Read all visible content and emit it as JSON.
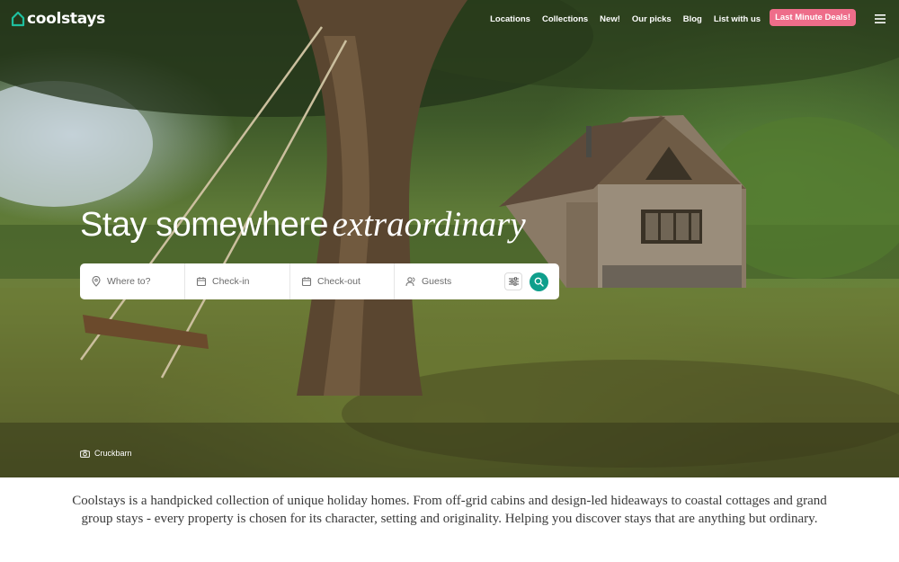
{
  "brand": {
    "name": "coolstays",
    "logo_icon": "house-outline-icon"
  },
  "nav": {
    "links": [
      "Locations",
      "Collections",
      "New!",
      "Our picks",
      "Blog",
      "List with us"
    ],
    "cta": "Last Minute Deals!",
    "menu_icon": "hamburger-menu-icon",
    "cta_color": "#ee6d8a"
  },
  "hero": {
    "headline_plain": "Stay somewhere",
    "headline_italic": "extraordinary",
    "caption": "Cruckbarn",
    "caption_icon": "camera-icon"
  },
  "search": {
    "where": "Where to?",
    "checkin": "Check-in",
    "checkout": "Check-out",
    "guests": "Guests",
    "accent": "#0f9f8c"
  },
  "intro": {
    "text": "Coolstays is a handpicked collection of unique holiday homes. From off-grid cabins and design-led hideaways to coastal cottages and grand group stays - every property is chosen for its character, setting and originality. Helping you discover stays that are anything but ordinary."
  }
}
